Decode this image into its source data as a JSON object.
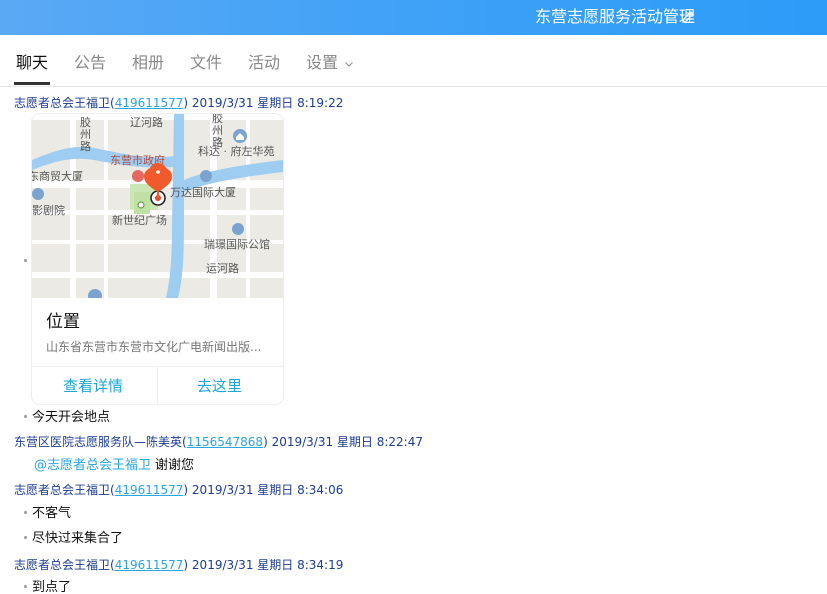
{
  "header": {
    "group_title": "东营志愿服务活动管理",
    "edit_icon": "edit-pencil-icon",
    "gradient_start": "#5aa9f5",
    "gradient_end": "#2c9cf8"
  },
  "tabs": [
    {
      "label": "聊天",
      "active": true
    },
    {
      "label": "公告"
    },
    {
      "label": "相册"
    },
    {
      "label": "文件"
    },
    {
      "label": "活动"
    },
    {
      "label": "设置"
    }
  ],
  "messages": [
    {
      "sender": "志愿者总会王福卫",
      "qq": "419611577",
      "datetime": "2019/3/31 星期日 8:19:22",
      "location": {
        "title": "位置",
        "address": "山东省东营市东营市文化广电新闻出版...",
        "detail_label": "查看详情",
        "goto_label": "去这里",
        "map_labels": {
          "road1": "辽河路",
          "zhou1a": "胶",
          "zhou1b": "州",
          "zhou1c": "路",
          "zhou2a": "胶",
          "zhou2b": "州",
          "zhou2c": "路",
          "gov": "东营市政府",
          "keda": "科达 · 府左华苑",
          "shangmao": "东商贸大厦",
          "wanda": "万达国际大厦",
          "yingjuyuan": "影剧院",
          "xinshiji": "新世纪广场",
          "ruijing": "瑞璟国际公馆",
          "yunhe": "运河路"
        }
      },
      "text": "今天开会地点"
    },
    {
      "sender": "东营区医院志愿服务队—陈美英",
      "qq": "1156547868",
      "datetime": "2019/3/31 星期日 8:22:47",
      "mention": "@志愿者总会王福卫",
      "text": "谢谢您"
    },
    {
      "sender": "志愿者总会王福卫",
      "qq": "419611577",
      "datetime": "2019/3/31 星期日 8:34:06",
      "lines": [
        "不客气",
        "尽快过来集合了"
      ]
    },
    {
      "sender": "志愿者总会王福卫",
      "qq": "419611577",
      "datetime": "2019/3/31 星期日 8:34:19",
      "text": "到点了"
    }
  ]
}
